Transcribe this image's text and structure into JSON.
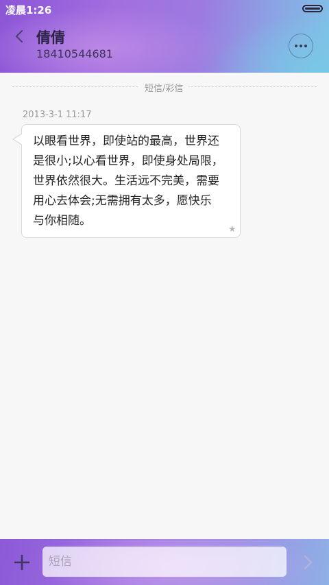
{
  "status_bar": {
    "time": "凌晨1:26"
  },
  "header": {
    "contact_name": "倩倩",
    "contact_number": "18410544681"
  },
  "thread": {
    "divider_label": "短信/彩信",
    "messages": [
      {
        "timestamp": "2013-3-1 11:17",
        "text": "以眼看世界，即使站的最高，世界还\n是很小;以心看世界，即使身处局限，\n世界依然很大。生活远不完美，需要\n用心去体会;无需拥有太多，愿快乐\n与你相随。"
      }
    ]
  },
  "composer": {
    "placeholder": "短信"
  },
  "icons": {
    "back": "chevron-left-icon",
    "more": "more-dots-icon",
    "star": "star-icon",
    "add": "plus-icon",
    "send": "chevron-right-icon"
  },
  "colors": {
    "accent_start": "#8b55d6",
    "accent_end": "#7fc3e6",
    "background": "#f7f7f7"
  }
}
